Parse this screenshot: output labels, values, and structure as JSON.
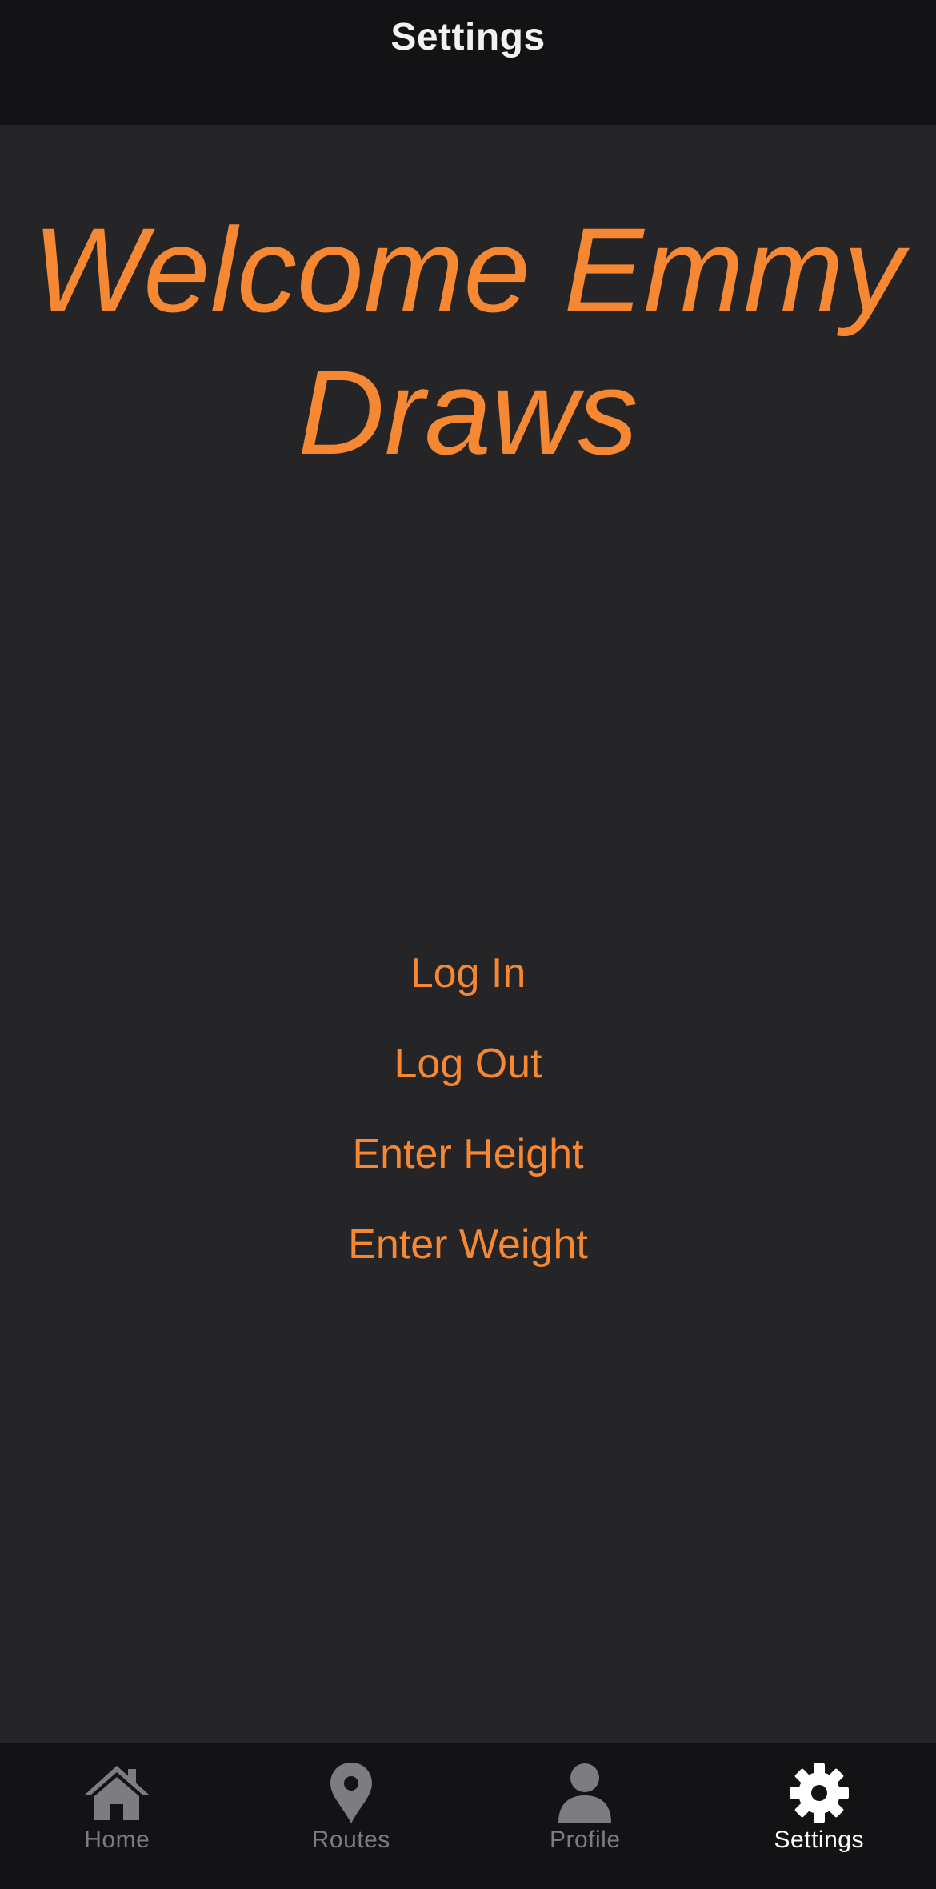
{
  "header": {
    "title": "Settings"
  },
  "main": {
    "welcome_text": "Welcome Emmy Draws",
    "actions": [
      {
        "label": "Log In"
      },
      {
        "label": "Log Out"
      },
      {
        "label": "Enter Height"
      },
      {
        "label": "Enter Weight"
      }
    ]
  },
  "tab_bar": {
    "tabs": [
      {
        "label": "Home",
        "icon": "home-icon",
        "active": false
      },
      {
        "label": "Routes",
        "icon": "map-pin-icon",
        "active": false
      },
      {
        "label": "Profile",
        "icon": "person-icon",
        "active": false
      },
      {
        "label": "Settings",
        "icon": "gear-icon",
        "active": true
      }
    ]
  },
  "colors": {
    "accent": "#f68833",
    "bar_background": "#131215",
    "content_background": "#252427",
    "inactive_tab": "#7d7c80",
    "active_tab": "#ffffff"
  }
}
